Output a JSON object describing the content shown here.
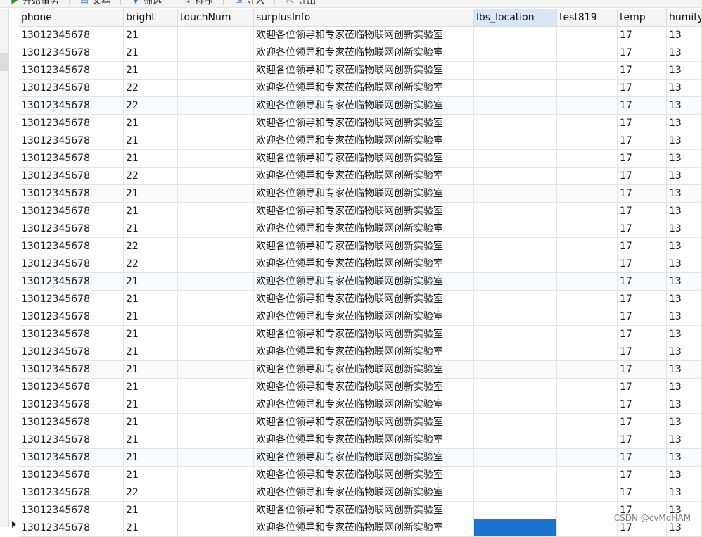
{
  "toolbar": {
    "buttons": [
      {
        "label": "开始事务",
        "icon": "transaction-icon"
      },
      {
        "label": "文本",
        "icon": "text-icon"
      },
      {
        "label": "筛选",
        "icon": "filter-icon"
      },
      {
        "label": "排序",
        "icon": "sort-icon"
      },
      {
        "label": "导入",
        "icon": "import-icon"
      },
      {
        "label": "导出",
        "icon": "export-icon"
      }
    ]
  },
  "columns": [
    "phone",
    "bright",
    "touchNum",
    "surplusInfo",
    "lbs_location",
    "test819",
    "temp",
    "humity"
  ],
  "selected_column": "lbs_location",
  "rows": [
    [
      "13012345678",
      "21",
      "",
      "欢迎各位领导和专家莅临物联网创新实验室",
      "",
      "",
      "17",
      "13"
    ],
    [
      "13012345678",
      "21",
      "",
      "欢迎各位领导和专家莅临物联网创新实验室",
      "",
      "",
      "17",
      "13"
    ],
    [
      "13012345678",
      "21",
      "",
      "欢迎各位领导和专家莅临物联网创新实验室",
      "",
      "",
      "17",
      "13"
    ],
    [
      "13012345678",
      "22",
      "",
      "欢迎各位领导和专家莅临物联网创新实验室",
      "",
      "",
      "17",
      "13"
    ],
    [
      "13012345678",
      "22",
      "",
      "欢迎各位领导和专家莅临物联网创新实验室",
      "",
      "",
      "17",
      "13"
    ],
    [
      "13012345678",
      "21",
      "",
      "欢迎各位领导和专家莅临物联网创新实验室",
      "",
      "",
      "17",
      "13"
    ],
    [
      "13012345678",
      "21",
      "",
      "欢迎各位领导和专家莅临物联网创新实验室",
      "",
      "",
      "17",
      "13"
    ],
    [
      "13012345678",
      "21",
      "",
      "欢迎各位领导和专家莅临物联网创新实验室",
      "",
      "",
      "17",
      "13"
    ],
    [
      "13012345678",
      "22",
      "",
      "欢迎各位领导和专家莅临物联网创新实验室",
      "",
      "",
      "17",
      "13"
    ],
    [
      "13012345678",
      "21",
      "",
      "欢迎各位领导和专家莅临物联网创新实验室",
      "",
      "",
      "17",
      "13"
    ],
    [
      "13012345678",
      "21",
      "",
      "欢迎各位领导和专家莅临物联网创新实验室",
      "",
      "",
      "17",
      "13"
    ],
    [
      "13012345678",
      "21",
      "",
      "欢迎各位领导和专家莅临物联网创新实验室",
      "",
      "",
      "17",
      "13"
    ],
    [
      "13012345678",
      "22",
      "",
      "欢迎各位领导和专家莅临物联网创新实验室",
      "",
      "",
      "17",
      "13"
    ],
    [
      "13012345678",
      "22",
      "",
      "欢迎各位领导和专家莅临物联网创新实验室",
      "",
      "",
      "17",
      "13"
    ],
    [
      "13012345678",
      "21",
      "",
      "欢迎各位领导和专家莅临物联网创新实验室",
      "",
      "",
      "17",
      "13"
    ],
    [
      "13012345678",
      "21",
      "",
      "欢迎各位领导和专家莅临物联网创新实验室",
      "",
      "",
      "17",
      "13"
    ],
    [
      "13012345678",
      "21",
      "",
      "欢迎各位领导和专家莅临物联网创新实验室",
      "",
      "",
      "17",
      "13"
    ],
    [
      "13012345678",
      "21",
      "",
      "欢迎各位领导和专家莅临物联网创新实验室",
      "",
      "",
      "17",
      "13"
    ],
    [
      "13012345678",
      "21",
      "",
      "欢迎各位领导和专家莅临物联网创新实验室",
      "",
      "",
      "17",
      "13"
    ],
    [
      "13012345678",
      "21",
      "",
      "欢迎各位领导和专家莅临物联网创新实验室",
      "",
      "",
      "17",
      "13"
    ],
    [
      "13012345678",
      "21",
      "",
      "欢迎各位领导和专家莅临物联网创新实验室",
      "",
      "",
      "17",
      "13"
    ],
    [
      "13012345678",
      "21",
      "",
      "欢迎各位领导和专家莅临物联网创新实验室",
      "",
      "",
      "17",
      "13"
    ],
    [
      "13012345678",
      "21",
      "",
      "欢迎各位领导和专家莅临物联网创新实验室",
      "",
      "",
      "17",
      "13"
    ],
    [
      "13012345678",
      "21",
      "",
      "欢迎各位领导和专家莅临物联网创新实验室",
      "",
      "",
      "17",
      "13"
    ],
    [
      "13012345678",
      "21",
      "",
      "欢迎各位领导和专家莅临物联网创新实验室",
      "",
      "",
      "17",
      "13"
    ],
    [
      "13012345678",
      "21",
      "",
      "欢迎各位领导和专家莅临物联网创新实验室",
      "",
      "",
      "17",
      "13"
    ],
    [
      "13012345678",
      "22",
      "",
      "欢迎各位领导和专家莅临物联网创新实验室",
      "",
      "",
      "17",
      "13"
    ],
    [
      "13012345678",
      "21",
      "",
      "欢迎各位领导和专家莅临物联网创新实验室",
      "",
      "",
      "17",
      "13"
    ],
    [
      "13012345678",
      "21",
      "",
      "欢迎各位领导和专家莅临物联网创新实验室",
      "",
      "",
      "17",
      "13"
    ]
  ],
  "active_row_index": 28,
  "selected_cell": {
    "row": 28,
    "col": 4
  },
  "colors": {
    "selected_cell": "#1a73d1",
    "selected_header": "#d7e7f6",
    "alt_row": "#f8fbfe"
  },
  "watermark": "CSDN @cvMdHAM"
}
